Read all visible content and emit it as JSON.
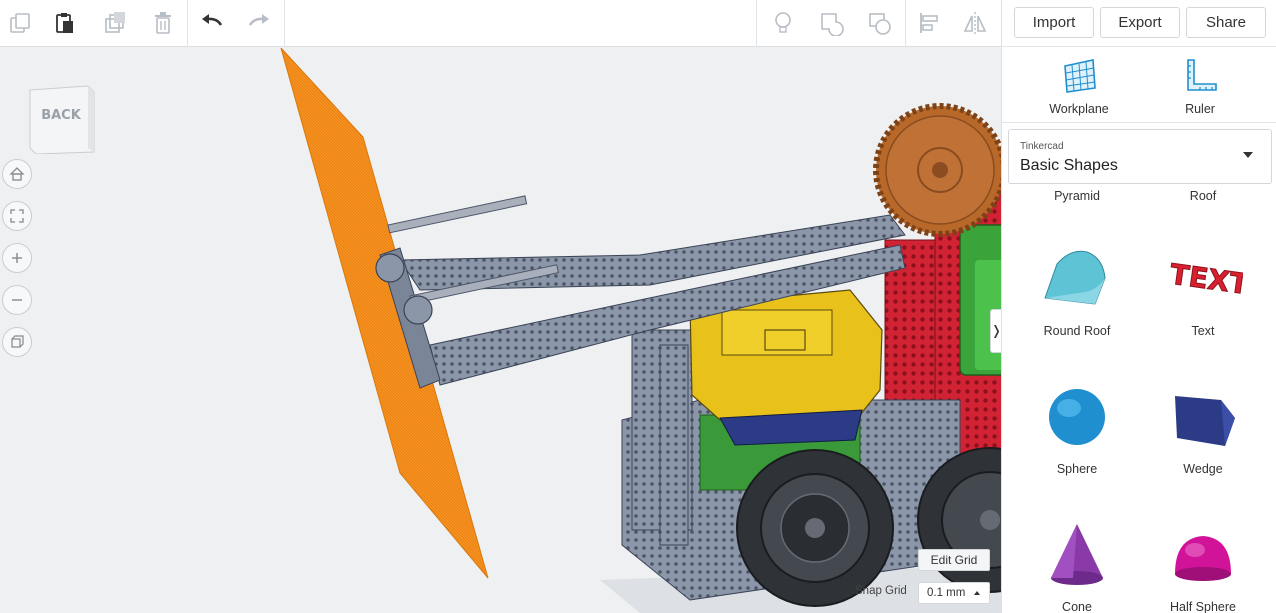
{
  "toolbar": {
    "left_tools": [
      "copy-icon",
      "paste-icon",
      "duplicate-icon",
      "delete-icon",
      "undo-icon",
      "redo-icon"
    ],
    "right_tools": [
      "lightbulb-icon",
      "group-icon",
      "ungroup-icon",
      "align-icon",
      "mirror-icon"
    ]
  },
  "header_buttons": {
    "import": "Import",
    "export": "Export",
    "share": "Share"
  },
  "tools": {
    "workplane": "Workplane",
    "ruler": "Ruler"
  },
  "library": {
    "provider": "Tinkercad",
    "name": "Basic Shapes"
  },
  "shapes": {
    "pyramid": "Pyramid",
    "roof": "Roof",
    "round_roof": "Round Roof",
    "text": "Text",
    "text_model_word": "TEXT",
    "sphere": "Sphere",
    "wedge": "Wedge",
    "cone": "Cone",
    "half_sphere": "Half Sphere"
  },
  "viewcube": {
    "face": "BACK"
  },
  "nav_controls": [
    "home-icon",
    "fit-view-icon",
    "zoom-in-icon",
    "zoom-out-icon",
    "perspective-icon"
  ],
  "grid": {
    "edit_label": "Edit Grid",
    "snap_label": "Snap Grid",
    "snap_value": "0.1 mm"
  },
  "colors": {
    "accent_orange": "#f7901e",
    "robot_grey": "#7e8a9c",
    "battery_yellow": "#e8c21a",
    "panel_red": "#cf2030",
    "shape_blue": "#1f8fcf",
    "wedge_navy": "#2b3b86",
    "cone_purple": "#8a3aa8",
    "half_sphere_magenta": "#d1139a"
  }
}
